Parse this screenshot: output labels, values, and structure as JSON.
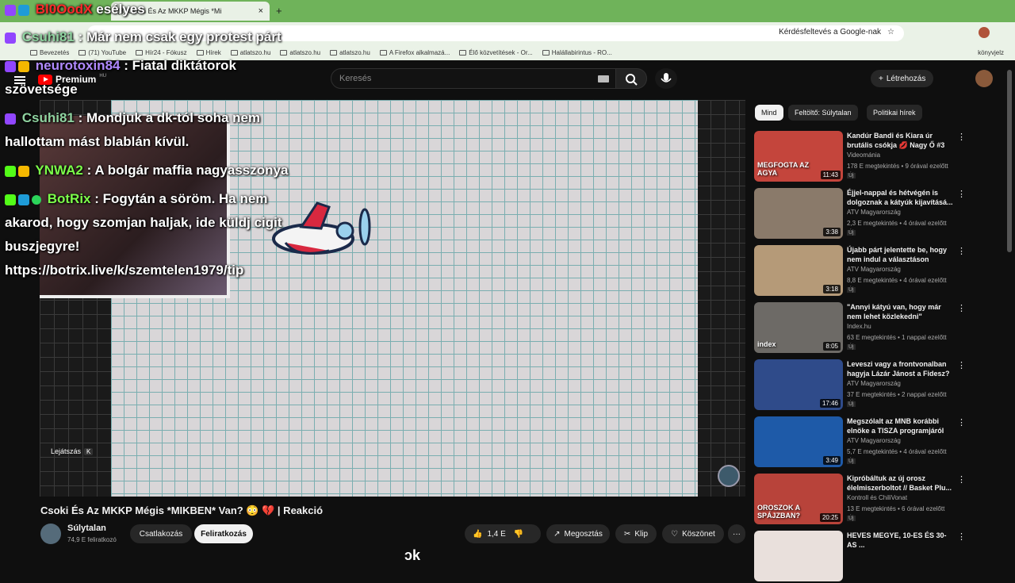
{
  "browser": {
    "active_tab_title": "(3) Csoki És Az MKKP Mégis *Mi",
    "new_tab_symbol": "+",
    "close_tab_symbol": "×",
    "omnibox_action": "Kérdésfeltevés a Google-nak",
    "bookmarks": [
      "Bevezetés",
      "(71) YouTube",
      "Hír24 - Fókusz",
      "Hírek",
      "atlatszo.hu",
      "atlatszo.hu",
      "atlatszo.hu",
      "A Firefox alkalmazá...",
      "Élő közvetítések - Or...",
      "Halállabirintus - RO..."
    ],
    "other_bookmarks": "könyvjelz"
  },
  "youtube": {
    "logo_text": "Premium",
    "logo_superscript": "HU",
    "search_placeholder": "Keresés",
    "create_label": "Létrehozás"
  },
  "chat": [
    {
      "user": "Bl0OodX",
      "sep": " ",
      "text": "esélyes",
      "color": "#ff2b2b"
    },
    {
      "user": "Csuhi81",
      "sep": " : ",
      "text": "Már nem csak egy protest párt",
      "color": "#8fd3a0"
    },
    {
      "user": "neurotoxin84",
      "sep": " : ",
      "text": "Fiatal diktátorok",
      "color": "#b089ff"
    },
    {
      "continuation": "szövetsége"
    },
    {
      "user": "Csuhi81",
      "sep": " : ",
      "text": "Mondjuk a dk-tól soha nem",
      "color": "#8fd3a0"
    },
    {
      "continuation": "hallottam mást blablán kívül."
    },
    {
      "user": "YNWA2",
      "sep": " : ",
      "text": "A bolgár maffia nagyasszonya",
      "color": "#7cff4a"
    },
    {
      "user": "BotRix",
      "sep": " : ",
      "text": "Fogytán a söröm. Ha nem",
      "color": "#7cff4a"
    },
    {
      "continuation": "akarod, hogy szomjan haljak, ide küldj cigit"
    },
    {
      "continuation": "buszjegyre!"
    },
    {
      "continuation": "https://botrix.live/k/szemtelen1979/tip"
    }
  ],
  "player": {
    "play_hint": "Lejátszás",
    "play_key": "K",
    "subtitle_fragment": "ɔk"
  },
  "video": {
    "title": "Csoki És Az MKKP Mégis *MIKBEN* Van? 😳 💔 | Reakció",
    "channel": "Súlytalan",
    "subscribers": "74,9 E feliratkozó",
    "join_label": "Csatlakozás",
    "subscribe_label": "Feliratkozás",
    "likes": "1,4 E",
    "share_label": "Megosztás",
    "clip_label": "Klip",
    "thanks_label": "Köszönet",
    "more_label": "···"
  },
  "sidebar": {
    "chips": [
      "Mind",
      "Feltöltő: Súlytalan",
      "Politikai hírek"
    ],
    "recommendations": [
      {
        "title": "Kandúr Bandi és Kiara úr brutális csókja 💋 Nagy Ő #3",
        "channel": "Videománia",
        "meta": "178 E megtekintés • 9 órával ezelőtt",
        "duration": "11:43",
        "thumb_color": "#c4453c",
        "thumb_text": "MEGFOGTA AZ AGYA",
        "new": "Új"
      },
      {
        "title": "Éjjel-nappal és hétvégén is dolgoznak a kátyúk kijavításá...",
        "channel": "ATV Magyarország",
        "meta": "2,3 E megtekintés • 4 órával ezelőtt",
        "duration": "3:38",
        "thumb_color": "#8a7a6a",
        "thumb_text": "",
        "new": "Új"
      },
      {
        "title": "Újabb párt jelentette be, hogy nem indul a választáson",
        "channel": "ATV Magyarország",
        "meta": "8,8 E megtekintés • 4 órával ezelőtt",
        "duration": "3:18",
        "thumb_color": "#b59a78",
        "thumb_text": "",
        "new": "Új"
      },
      {
        "title": "\"Annyi kátyú van, hogy már nem lehet közlekedni\"",
        "channel": "Index.hu",
        "meta": "63 E megtekintés • 1 nappal ezelőtt",
        "duration": "8:05",
        "thumb_color": "#6d6a66",
        "thumb_text": "index",
        "new": "Új"
      },
      {
        "title": "Leveszi vagy a frontvonalban hagyja Lázár Jánost a Fidesz?",
        "channel": "ATV Magyarország",
        "meta": "37 E megtekintés • 2 nappal ezelőtt",
        "duration": "17:46",
        "thumb_color": "#2f4b8a",
        "thumb_text": "",
        "new": "Új"
      },
      {
        "title": "Megszólalt az MNB korábbi elnöke a TISZA programjáról",
        "channel": "ATV Magyarország",
        "meta": "5,7 E megtekintés • 4 órával ezelőtt",
        "duration": "3:49",
        "thumb_color": "#1e5aa8",
        "thumb_text": "",
        "new": "Új"
      },
      {
        "title": "Kipróbáltuk az új orosz élelmiszerboltot // Basket Plu...",
        "channel": "Kontroll és ChiliVonat",
        "meta": "13 E megtekintés • 6 órával ezelőtt",
        "duration": "20:25",
        "thumb_color": "#b8433a",
        "thumb_text": "OROSZOK A SPÁJZBAN?",
        "new": "Új"
      },
      {
        "title": "HEVES MEGYE, 10-ES ÉS 30-AS ...",
        "channel": "",
        "meta": "",
        "duration": "",
        "thumb_color": "#e9e0dc",
        "thumb_text": "",
        "new": ""
      }
    ]
  },
  "colors": {
    "tabstrip": "#6fb35a",
    "toolbar": "#eaf2e7",
    "page_bg": "#0f0f0f",
    "accent_red": "#ff0000"
  }
}
